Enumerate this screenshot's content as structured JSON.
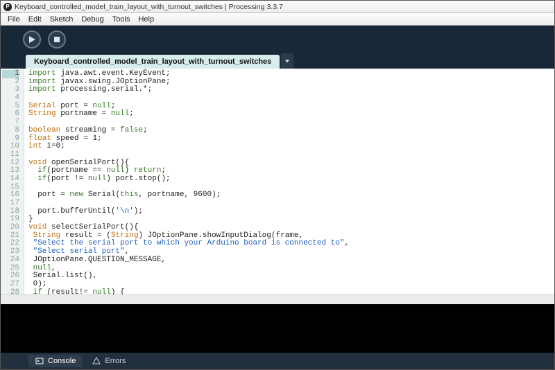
{
  "titlebar": {
    "icon_label": "P",
    "text": "Keyboard_controlled_model_train_layout_with_turnout_switches | Processing 3.3.7"
  },
  "menu": {
    "items": [
      "File",
      "Edit",
      "Sketch",
      "Debug",
      "Tools",
      "Help"
    ]
  },
  "tab": {
    "label": "Keyboard_controlled_model_train_layout_with_turnout_switches"
  },
  "code_lines": [
    {
      "n": 1,
      "tokens": [
        {
          "t": "import",
          "c": "kw"
        },
        {
          "t": " java.awt.event.KeyEvent;",
          "c": ""
        }
      ]
    },
    {
      "n": 2,
      "tokens": [
        {
          "t": "import",
          "c": "kw"
        },
        {
          "t": " javax.swing.JOptionPane;",
          "c": ""
        }
      ]
    },
    {
      "n": 3,
      "tokens": [
        {
          "t": "import",
          "c": "kw"
        },
        {
          "t": " processing.serial.*;",
          "c": ""
        }
      ]
    },
    {
      "n": 4,
      "tokens": []
    },
    {
      "n": 5,
      "tokens": [
        {
          "t": "Serial",
          "c": "typ"
        },
        {
          "t": " port = ",
          "c": ""
        },
        {
          "t": "null",
          "c": "null"
        },
        {
          "t": ";",
          "c": ""
        }
      ]
    },
    {
      "n": 6,
      "tokens": [
        {
          "t": "String",
          "c": "typ"
        },
        {
          "t": " portname = ",
          "c": ""
        },
        {
          "t": "null",
          "c": "null"
        },
        {
          "t": ";",
          "c": ""
        }
      ]
    },
    {
      "n": 7,
      "tokens": []
    },
    {
      "n": 8,
      "tokens": [
        {
          "t": "boolean",
          "c": "typ"
        },
        {
          "t": " streaming = ",
          "c": ""
        },
        {
          "t": "false",
          "c": "null"
        },
        {
          "t": ";",
          "c": ""
        }
      ]
    },
    {
      "n": 9,
      "tokens": [
        {
          "t": "float",
          "c": "typ"
        },
        {
          "t": " speed = ",
          "c": ""
        },
        {
          "t": "1",
          "c": "num"
        },
        {
          "t": ";",
          "c": ""
        }
      ]
    },
    {
      "n": 10,
      "tokens": [
        {
          "t": "int",
          "c": "typ"
        },
        {
          "t": " i=",
          "c": ""
        },
        {
          "t": "0",
          "c": "num"
        },
        {
          "t": ";",
          "c": ""
        }
      ]
    },
    {
      "n": 11,
      "tokens": []
    },
    {
      "n": 12,
      "tokens": [
        {
          "t": "void",
          "c": "typ"
        },
        {
          "t": " openSerialPort(){",
          "c": ""
        }
      ]
    },
    {
      "n": 13,
      "tokens": [
        {
          "t": "  ",
          "c": ""
        },
        {
          "t": "if",
          "c": "kw"
        },
        {
          "t": "(portname == ",
          "c": ""
        },
        {
          "t": "null",
          "c": "null"
        },
        {
          "t": ") ",
          "c": ""
        },
        {
          "t": "return",
          "c": "kw"
        },
        {
          "t": ";",
          "c": ""
        }
      ]
    },
    {
      "n": 14,
      "tokens": [
        {
          "t": "  ",
          "c": ""
        },
        {
          "t": "if",
          "c": "kw"
        },
        {
          "t": "(port != ",
          "c": ""
        },
        {
          "t": "null",
          "c": "null"
        },
        {
          "t": ") port.stop();",
          "c": ""
        }
      ]
    },
    {
      "n": 15,
      "tokens": []
    },
    {
      "n": 16,
      "tokens": [
        {
          "t": "  port = ",
          "c": ""
        },
        {
          "t": "new",
          "c": "kw"
        },
        {
          "t": " Serial(",
          "c": ""
        },
        {
          "t": "this",
          "c": "kw"
        },
        {
          "t": ", portname, ",
          "c": ""
        },
        {
          "t": "9600",
          "c": "num"
        },
        {
          "t": ");",
          "c": ""
        }
      ]
    },
    {
      "n": 17,
      "tokens": []
    },
    {
      "n": 18,
      "tokens": [
        {
          "t": "  port.bufferUntil(",
          "c": ""
        },
        {
          "t": "'\\n'",
          "c": "str"
        },
        {
          "t": ");",
          "c": ""
        }
      ]
    },
    {
      "n": 19,
      "tokens": [
        {
          "t": "}",
          "c": ""
        }
      ]
    },
    {
      "n": 20,
      "tokens": [
        {
          "t": "void",
          "c": "typ"
        },
        {
          "t": " selectSerialPort(){",
          "c": ""
        }
      ]
    },
    {
      "n": 21,
      "tokens": [
        {
          "t": " ",
          "c": ""
        },
        {
          "t": "String",
          "c": "typ"
        },
        {
          "t": " result = (",
          "c": ""
        },
        {
          "t": "String",
          "c": "typ"
        },
        {
          "t": ") JOptionPane.showInputDialog(frame,",
          "c": ""
        }
      ]
    },
    {
      "n": 22,
      "tokens": [
        {
          "t": " ",
          "c": ""
        },
        {
          "t": "\"Select the serial port to which your Arduino board is connected to\"",
          "c": "str"
        },
        {
          "t": ",",
          "c": ""
        }
      ]
    },
    {
      "n": 23,
      "tokens": [
        {
          "t": " ",
          "c": ""
        },
        {
          "t": "\"Select serial port\"",
          "c": "str"
        },
        {
          "t": ",",
          "c": ""
        }
      ]
    },
    {
      "n": 24,
      "tokens": [
        {
          "t": " JOptionPane.QUESTION_MESSAGE,",
          "c": ""
        }
      ]
    },
    {
      "n": 25,
      "tokens": [
        {
          "t": " ",
          "c": ""
        },
        {
          "t": "null",
          "c": "null"
        },
        {
          "t": ",",
          "c": ""
        }
      ]
    },
    {
      "n": 26,
      "tokens": [
        {
          "t": " Serial.list(),",
          "c": ""
        }
      ]
    },
    {
      "n": 27,
      "tokens": [
        {
          "t": " ",
          "c": ""
        },
        {
          "t": "0",
          "c": "num"
        },
        {
          "t": ");",
          "c": ""
        }
      ]
    },
    {
      "n": 28,
      "tokens": [
        {
          "t": " ",
          "c": ""
        },
        {
          "t": "if",
          "c": "kw"
        },
        {
          "t": " (result!= ",
          "c": ""
        },
        {
          "t": "null",
          "c": "null"
        },
        {
          "t": ") {",
          "c": ""
        }
      ]
    }
  ],
  "bottom": {
    "console": "Console",
    "errors": "Errors"
  }
}
